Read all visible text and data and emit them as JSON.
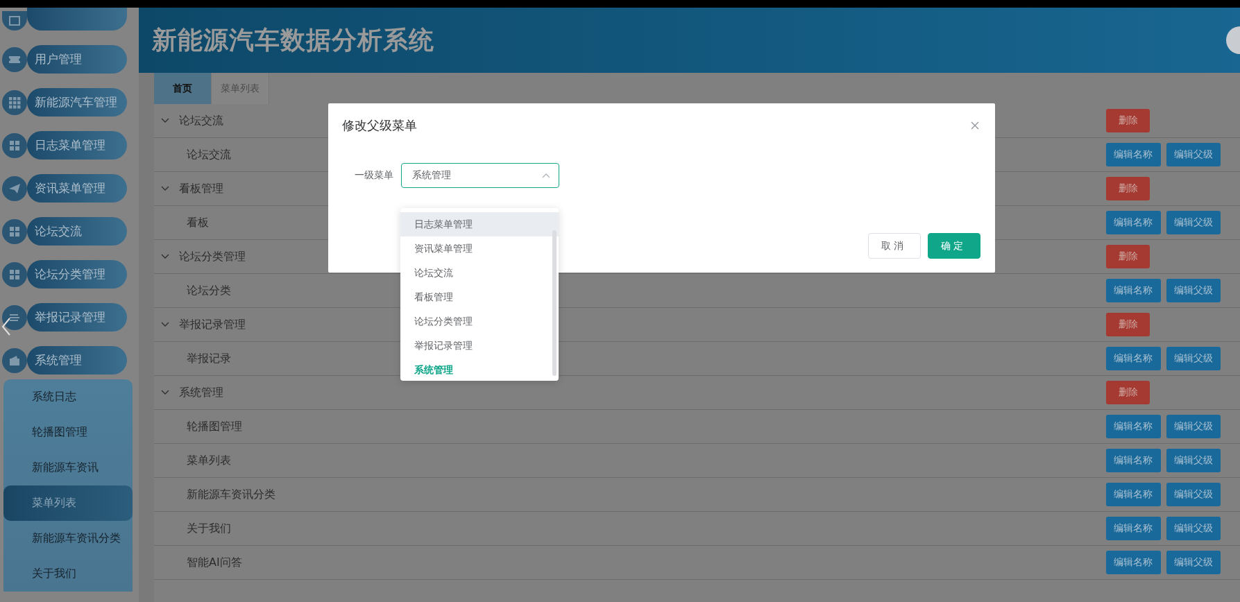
{
  "header": {
    "title": "新能源汽车数据分析系统"
  },
  "sidebar": {
    "items": [
      {
        "kind": "cut"
      },
      {
        "label": "用户管理"
      },
      {
        "label": "新能源汽车管理"
      },
      {
        "label": "日志菜单管理"
      },
      {
        "label": "资讯菜单管理"
      },
      {
        "label": "论坛交流"
      },
      {
        "label": "论坛分类管理"
      },
      {
        "label": "举报记录管理"
      },
      {
        "label": "系统管理",
        "children": [
          {
            "label": "系统日志",
            "selected": false
          },
          {
            "label": "轮播图管理",
            "selected": false
          },
          {
            "label": "新能源车资讯",
            "selected": false
          },
          {
            "label": "菜单列表",
            "selected": true
          },
          {
            "label": "新能源车资讯分类",
            "selected": false
          },
          {
            "label": "关于我们",
            "selected": false
          }
        ]
      }
    ]
  },
  "tabs": [
    {
      "label": "首页",
      "selected": true
    },
    {
      "label": "菜单列表",
      "selected": false
    }
  ],
  "table": {
    "rows": [
      {
        "kind": "parent",
        "name": "论坛交流",
        "expanded": true,
        "actions": [
          {
            "label": "删除",
            "kind": "delete"
          }
        ]
      },
      {
        "kind": "child",
        "name": "论坛交流",
        "actions": [
          {
            "label": "编辑名称",
            "kind": "edit"
          },
          {
            "label": "编辑父级",
            "kind": "edit"
          }
        ]
      },
      {
        "kind": "parent",
        "name": "看板管理",
        "expanded": true,
        "actions": [
          {
            "label": "删除",
            "kind": "delete"
          }
        ]
      },
      {
        "kind": "child",
        "name": "看板",
        "actions": [
          {
            "label": "编辑名称",
            "kind": "edit"
          },
          {
            "label": "编辑父级",
            "kind": "edit"
          }
        ]
      },
      {
        "kind": "parent",
        "name": "论坛分类管理",
        "expanded": true,
        "actions": [
          {
            "label": "删除",
            "kind": "delete"
          }
        ]
      },
      {
        "kind": "child",
        "name": "论坛分类",
        "actions": [
          {
            "label": "编辑名称",
            "kind": "edit"
          },
          {
            "label": "编辑父级",
            "kind": "edit"
          }
        ]
      },
      {
        "kind": "parent",
        "name": "举报记录管理",
        "expanded": true,
        "actions": [
          {
            "label": "删除",
            "kind": "delete"
          }
        ]
      },
      {
        "kind": "child",
        "name": "举报记录",
        "actions": [
          {
            "label": "编辑名称",
            "kind": "edit"
          },
          {
            "label": "编辑父级",
            "kind": "edit"
          }
        ]
      },
      {
        "kind": "parent",
        "name": "系统管理",
        "expanded": true,
        "actions": [
          {
            "label": "删除",
            "kind": "delete"
          }
        ]
      },
      {
        "kind": "child",
        "name": "轮播图管理",
        "actions": [
          {
            "label": "编辑名称",
            "kind": "edit"
          },
          {
            "label": "编辑父级",
            "kind": "edit"
          }
        ]
      },
      {
        "kind": "child",
        "name": "菜单列表",
        "actions": [
          {
            "label": "编辑名称",
            "kind": "edit"
          },
          {
            "label": "编辑父级",
            "kind": "edit"
          }
        ]
      },
      {
        "kind": "child",
        "name": "新能源车资讯分类",
        "actions": [
          {
            "label": "编辑名称",
            "kind": "edit"
          },
          {
            "label": "编辑父级",
            "kind": "edit"
          }
        ]
      },
      {
        "kind": "child",
        "name": "关于我们",
        "actions": [
          {
            "label": "编辑名称",
            "kind": "edit"
          },
          {
            "label": "编辑父级",
            "kind": "edit"
          }
        ]
      },
      {
        "kind": "child",
        "name": "智能AI问答",
        "actions": [
          {
            "label": "编辑名称",
            "kind": "edit"
          },
          {
            "label": "编辑父级",
            "kind": "edit"
          }
        ]
      }
    ]
  },
  "dialog": {
    "title": "修改父级菜单",
    "field_label": "一级菜单",
    "value": "系统管理",
    "open": true,
    "options": [
      {
        "label": "日志菜单管理",
        "selected": false,
        "hovered": true
      },
      {
        "label": "资讯菜单管理",
        "selected": false,
        "hovered": false
      },
      {
        "label": "论坛交流",
        "selected": false,
        "hovered": false
      },
      {
        "label": "看板管理",
        "selected": false,
        "hovered": false
      },
      {
        "label": "论坛分类管理",
        "selected": false,
        "hovered": false
      },
      {
        "label": "举报记录管理",
        "selected": false,
        "hovered": false
      },
      {
        "label": "系统管理",
        "selected": true,
        "hovered": false
      }
    ],
    "buttons": [
      {
        "label": "取消",
        "kind": "secondary"
      },
      {
        "label": "确定",
        "kind": "primary"
      }
    ]
  }
}
